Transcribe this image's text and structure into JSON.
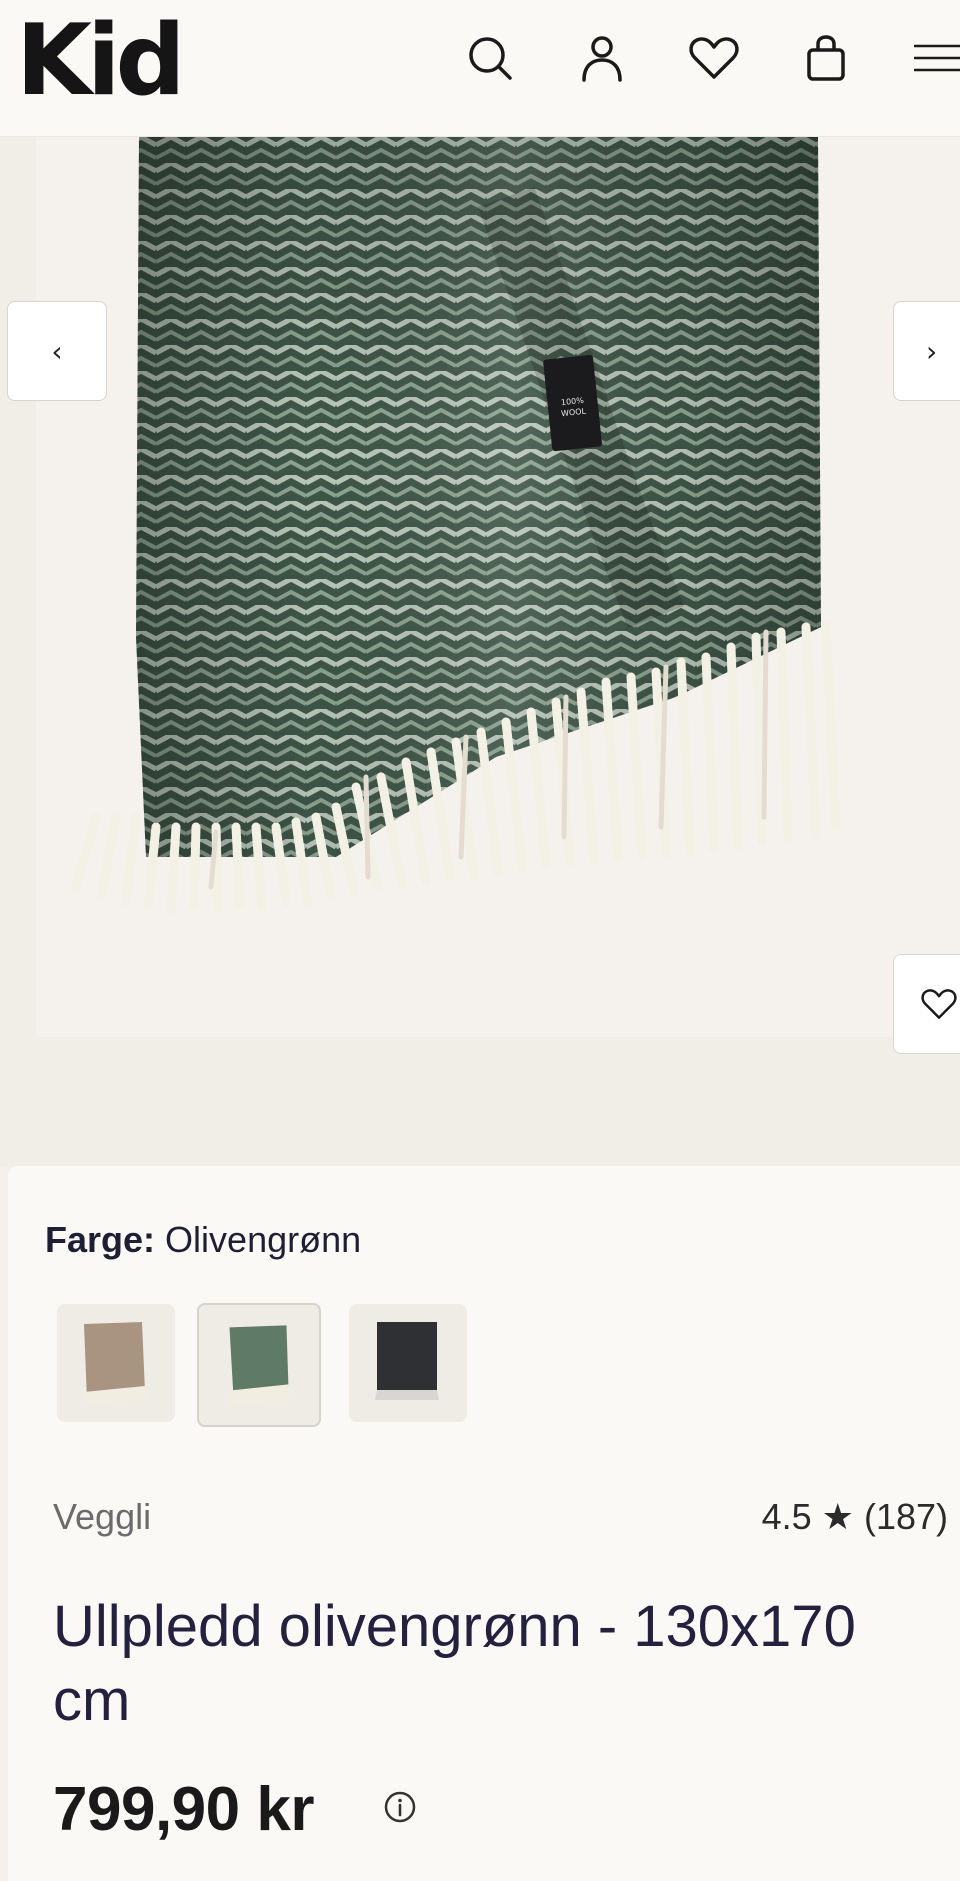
{
  "header": {
    "logo": "Kid",
    "icons": [
      "search-icon",
      "user-icon",
      "heart-icon",
      "bag-icon",
      "menu-icon"
    ]
  },
  "gallery": {
    "label_text": "100% WOOL",
    "prev_symbol": "‹",
    "next_symbol": "›"
  },
  "product": {
    "color_label": "Farge:",
    "color_value": "Olivengrønn",
    "swatches": [
      {
        "name": "Beige",
        "color": "#a89481"
      },
      {
        "name": "Olivengrønn",
        "color": "#5f7a66"
      },
      {
        "name": "Mørk grå",
        "color": "#2f3033"
      }
    ],
    "brand": "Veggli",
    "rating_value": "4.5",
    "rating_star": "★",
    "rating_count": "(187)",
    "title": "Ullpledd olivengrønn - 130x170 cm",
    "price": "799,90 kr"
  },
  "colors": {
    "header_bg": "#fbf9f5",
    "page_bg": "#f1ede7",
    "text_primary": "#23213d",
    "blanket_dark": "#3f5647",
    "blanket_light": "#b9c7b9",
    "fringe": "#f3f0e6"
  }
}
